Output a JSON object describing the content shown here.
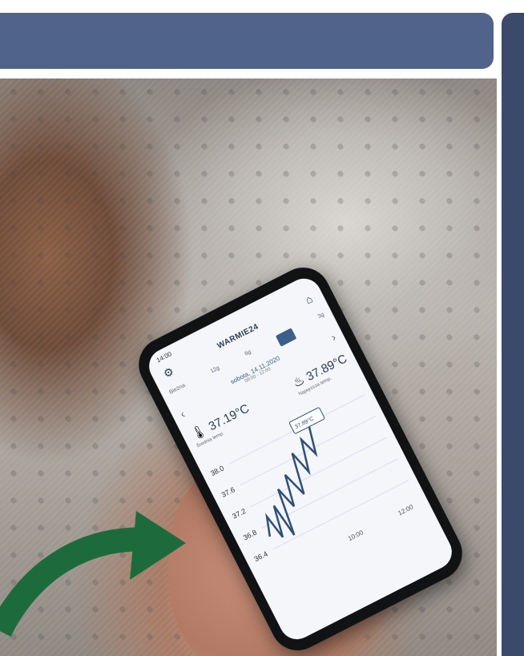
{
  "phone": {
    "status_time": "14:00",
    "app_title": "WARMIE24",
    "tabs": [
      "Bieżna",
      "12g",
      "6g",
      "",
      "3g"
    ],
    "date": "sobota, 14.11.2020",
    "date_sub": "09:00 - 12:00",
    "nav_left": "‹",
    "nav_right": "›",
    "avg_temp": "37.19°C",
    "avg_label": "Średnia temp.",
    "max_temp": "37.89°C",
    "max_label": "Najwyższa temp.",
    "y_ticks": [
      "38.0",
      "37.6",
      "37.2",
      "36.8",
      "36.4"
    ],
    "x_ticks": [
      "10:00",
      "12:00"
    ],
    "tooltip": "37.89°C",
    "icons": {
      "settings": "gear-icon",
      "home": "home-icon",
      "thermometer": "thermometer-icon",
      "peak": "flame-icon"
    }
  },
  "colors": {
    "banner": "#50638a",
    "strip": "#3b4a6a",
    "arrow": "#1d6b3c",
    "chart_line": "#2e4f78"
  }
}
